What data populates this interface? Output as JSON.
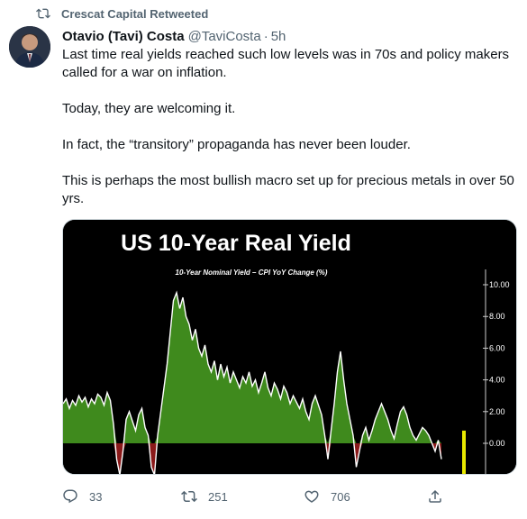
{
  "retweet": {
    "label": "Crescat Capital Retweeted",
    "icon": "retweet-icon"
  },
  "author": {
    "display_name": "Otavio (Tavi) Costa",
    "handle": "@TaviCosta",
    "separator": "·",
    "time": "5h"
  },
  "tweet": {
    "paragraphs": [
      "Last time real yields reached such low levels was in 70s and policy makers called for a war on inflation.",
      "Today, they are welcoming it.",
      "In fact, the “transitory” propaganda has never been louder.",
      "This is perhaps the most bullish macro set up for precious metals in over 50 yrs."
    ]
  },
  "media": {
    "title": "US 10-Year Real Yield",
    "subtitle": "10-Year Nominal Yield – CPI YoY Change (%)",
    "chart_data": {
      "type": "area",
      "title": "US 10-Year Real Yield",
      "subtitle": "10-Year Nominal Yield – CPI YoY Change (%)",
      "xlabel": "",
      "ylabel": "",
      "ylim": [
        -2,
        11
      ],
      "yticks": [
        "10.00",
        "8.00",
        "6.00",
        "4.00",
        "2.00",
        "0.00"
      ],
      "ytick_values": [
        10,
        8,
        6,
        4,
        2,
        0
      ],
      "grid": false,
      "colors": {
        "positive": "#3f8a1d",
        "negative": "#8b1a1a",
        "line": "#ffffff",
        "marker": "#e8e800",
        "background": "#000000"
      },
      "values": [
        2.5,
        2.8,
        2.2,
        2.7,
        2.4,
        3.0,
        2.6,
        2.9,
        2.3,
        2.8,
        2.5,
        3.1,
        2.9,
        2.4,
        3.2,
        2.7,
        1.2,
        -1.0,
        -2.0,
        -0.5,
        1.5,
        2.0,
        1.4,
        0.8,
        1.8,
        2.2,
        1.0,
        0.5,
        -1.5,
        -2.0,
        0.5,
        2.0,
        3.5,
        5.0,
        7.0,
        9.0,
        9.5,
        8.5,
        9.2,
        8.0,
        7.5,
        6.5,
        7.2,
        6.0,
        5.5,
        6.2,
        5.0,
        4.5,
        5.2,
        4.0,
        5.0,
        4.2,
        4.8,
        3.8,
        4.5,
        4.0,
        3.5,
        4.2,
        3.8,
        4.5,
        3.6,
        4.0,
        3.2,
        3.8,
        4.5,
        3.5,
        3.0,
        3.8,
        3.4,
        2.8,
        3.6,
        3.2,
        2.5,
        3.0,
        2.6,
        2.2,
        2.8,
        2.0,
        1.5,
        2.5,
        3.0,
        2.4,
        1.8,
        0.5,
        -1.0,
        0.8,
        2.5,
        4.5,
        5.8,
        4.0,
        2.5,
        1.5,
        0.5,
        -1.5,
        -0.5,
        0.5,
        1.0,
        0.2,
        0.8,
        1.5,
        2.0,
        2.5,
        2.0,
        1.5,
        0.8,
        0.3,
        1.2,
        2.0,
        2.3,
        1.8,
        1.0,
        0.5,
        0.2,
        0.6,
        1.0,
        0.8,
        0.5,
        0.0,
        -0.5,
        0.2,
        -1.0
      ],
      "extra_mark": {
        "value": 0.8,
        "color": "#e8e800"
      }
    }
  },
  "actions": {
    "reply": {
      "icon": "reply-icon",
      "count": "33"
    },
    "retweet": {
      "icon": "retweet-icon",
      "count": "251"
    },
    "like": {
      "icon": "heart-icon",
      "count": "706"
    },
    "share": {
      "icon": "share-icon"
    }
  }
}
